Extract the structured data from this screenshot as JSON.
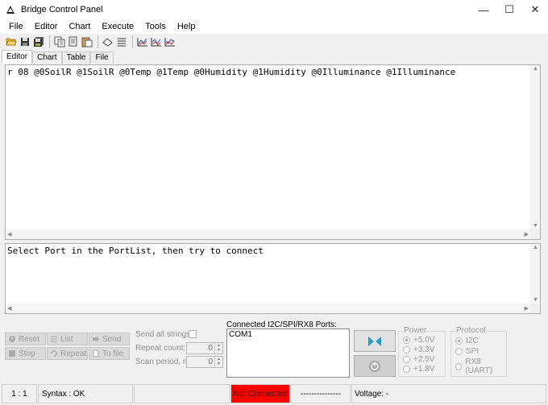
{
  "window": {
    "title": "Bridge Control Panel"
  },
  "window_controls": {
    "minimize": "—",
    "maximize": "☐",
    "close": "✕"
  },
  "menu": {
    "items": [
      "File",
      "Editor",
      "Chart",
      "Execute",
      "Tools",
      "Help"
    ]
  },
  "toolbar": {
    "icons": [
      "open-folder-icon",
      "save-icon",
      "save-all-icon",
      "copy-icon",
      "cut-icon",
      "paste-icon",
      "eraser-icon",
      "list-icon",
      "chart-icon",
      "chart2-icon",
      "chart3-icon"
    ]
  },
  "tabs": [
    "Editor",
    "Chart",
    "Table",
    "File"
  ],
  "editor": {
    "text": "r 08 @0SoilR @1SoilR @0Temp @1Temp @0Humidity @1Humidity @0Illuminance @1Illuminance"
  },
  "console": {
    "text": "Select Port in the PortList, then try to connect"
  },
  "controls": {
    "reset": "Reset",
    "list": "List",
    "send": "Send",
    "stop": "Stop",
    "repeat": "Repeat",
    "to_file": "To file",
    "send_all_strings": "Send all strings:",
    "repeat_count": "Repeat count:",
    "repeat_count_value": "0",
    "scan_period": "Scan period, ms:",
    "scan_period_value": "0"
  },
  "ports": {
    "label": "Connected I2C/SPI/RX8 Ports:",
    "items": [
      "COM1"
    ]
  },
  "power": {
    "title": "Power",
    "options": [
      "+5.0V",
      "+3.3V",
      "+2.5V",
      "+1.8V"
    ],
    "selected": "+5.0V"
  },
  "protocol": {
    "title": "Protocol",
    "options": [
      "I2C",
      "SPI",
      "RX8 (UART)"
    ],
    "selected": "I2C"
  },
  "status": {
    "position": "1 : 1",
    "syntax": "Syntax : OK",
    "connection": "Not Connected",
    "dashes": "---------------",
    "voltage": "Voltage: -",
    "connection_color": "#ff0000"
  }
}
